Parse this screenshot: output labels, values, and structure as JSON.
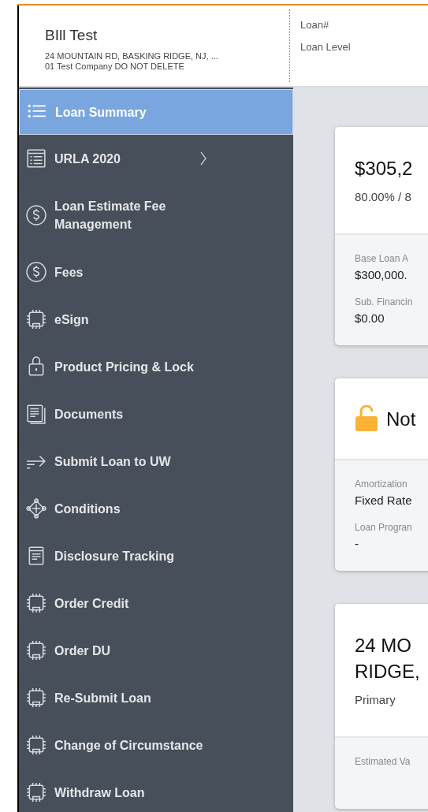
{
  "header": {
    "borrower": "BIll Test",
    "address": "24 MOUNTAIN RD, BASKING RIDGE, NJ, ...",
    "company": "01 Test Company DO NOT DELETE",
    "fields": [
      "Loan#",
      "Loan Level"
    ]
  },
  "sidebar": {
    "items": [
      {
        "label": "Loan Summary",
        "kind": "list",
        "selected": true
      },
      {
        "label": "URLA 2020",
        "kind": "form",
        "selected": false,
        "submenu": true
      },
      {
        "label": "Loan Estimate Fee Management",
        "kind": "dollar",
        "selected": false
      },
      {
        "label": "Fees",
        "kind": "dollar",
        "selected": false
      },
      {
        "label": "eSign",
        "kind": "chip",
        "selected": false
      },
      {
        "label": "Product Pricing & Lock",
        "kind": "lock",
        "selected": false
      },
      {
        "label": "Documents",
        "kind": "docs",
        "selected": false
      },
      {
        "label": "Submit Loan to UW",
        "kind": "send",
        "selected": false
      },
      {
        "label": "Conditions",
        "kind": "network",
        "selected": false
      },
      {
        "label": "Disclosure Tracking",
        "kind": "doc",
        "selected": false
      },
      {
        "label": "Order Credit",
        "kind": "chip",
        "selected": false
      },
      {
        "label": "Order DU",
        "kind": "chip",
        "selected": false
      },
      {
        "label": "Re-Submit Loan",
        "kind": "chip",
        "selected": false
      },
      {
        "label": "Change of Circumstance",
        "kind": "chip",
        "selected": false
      },
      {
        "label": "Withdraw Loan",
        "kind": "chip",
        "selected": false
      }
    ]
  },
  "cards": [
    {
      "kind": "amount",
      "title": "$305,2",
      "subtitle": "80.00% / 8",
      "fields": [
        {
          "label": "Base Loan A",
          "value": "$300,000."
        },
        {
          "label": "Sub. Financin",
          "value": "$0.00"
        }
      ]
    },
    {
      "kind": "lock",
      "title": "Not",
      "fields": [
        {
          "label": "Amortization",
          "value": "Fixed Rate"
        },
        {
          "label": "Loan Progran",
          "value": "-"
        }
      ]
    },
    {
      "kind": "property",
      "title": "24 MO\nRIDGE,",
      "subtitle": "Primary",
      "fields": [
        {
          "label": "Estimated Va"
        }
      ]
    }
  ]
}
